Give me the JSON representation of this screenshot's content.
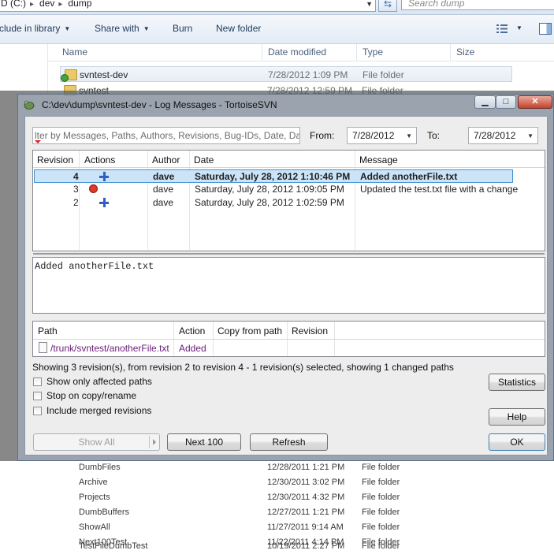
{
  "explorer": {
    "address_parts": [
      "D (C:)",
      "dev",
      "dump"
    ],
    "search_placeholder": "Search dump",
    "toolbar": {
      "include_in_library": "clude in library",
      "share_with": "Share with",
      "burn": "Burn",
      "new_folder": "New folder"
    },
    "columns": [
      "Name",
      "Date modified",
      "Type",
      "Size"
    ],
    "rows": [
      {
        "name": "svntest-dev",
        "date": "7/28/2012 1:09 PM",
        "type": "File folder"
      },
      {
        "name": "svntest",
        "date": "7/28/2012 12:59 PM",
        "type": "File folder"
      }
    ],
    "ghost_rows": [
      {
        "name": "DumbFiles",
        "date": "12/28/2011 1:21 PM",
        "type": "File folder"
      },
      {
        "name": "Archive",
        "date": "12/30/2011 3:02 PM",
        "type": "File folder"
      },
      {
        "name": "Projects",
        "date": "12/30/2011 4:32 PM",
        "type": "File folder"
      },
      {
        "name": "DumbBuffers",
        "date": "12/27/2011 1:21 PM",
        "type": "File folder"
      },
      {
        "name": "ShowAll",
        "date": "11/27/2011 9:14 AM",
        "type": "File folder"
      },
      {
        "name": "Next100Test",
        "date": "11/22/2011 4:14 PM",
        "type": "File folder"
      },
      {
        "name": "TestFileDumbTest",
        "date": "10/19/2011 2:27 PM",
        "type": "File folder"
      }
    ]
  },
  "dialog": {
    "title": "C:\\dev\\dump\\svntest-dev - Log Messages - TortoiseSVN",
    "filter_placeholder": "lter by Messages, Paths, Authors, Revisions, Bug-IDs, Date, Date Rar",
    "from_label": "From:",
    "from_value": "7/28/2012",
    "to_label": "To:",
    "to_value": "7/28/2012",
    "log_columns": [
      "Revision",
      "Actions",
      "Author",
      "Date",
      "Message"
    ],
    "log_rows": [
      {
        "revision": "4",
        "action": "added",
        "author": "dave",
        "date": "Saturday, July 28, 2012 1:10:46 PM",
        "message": "Added anotherFile.txt",
        "selected": true
      },
      {
        "revision": "3",
        "action": "modified",
        "author": "dave",
        "date": "Saturday, July 28, 2012 1:09:05 PM",
        "message": "Updated the test.txt file with a change",
        "selected": false
      },
      {
        "revision": "2",
        "action": "added",
        "author": "dave",
        "date": "Saturday, July 28, 2012 1:02:59 PM",
        "message": "",
        "selected": false
      }
    ],
    "message_text": "Added anotherFile.txt",
    "path_columns": [
      "Path",
      "Action",
      "Copy from path",
      "Revision"
    ],
    "path_rows": [
      {
        "path": "/trunk/svntest/anotherFile.txt",
        "action": "Added",
        "copy_from": "",
        "revision": ""
      }
    ],
    "status": "Showing 3 revision(s), from revision 2 to revision 4 - 1 revision(s) selected, showing 1 changed paths",
    "checkboxes": {
      "show_only_affected": "Show only affected paths",
      "stop_on_copy": "Stop on copy/rename",
      "include_merged": "Include merged revisions"
    },
    "buttons": {
      "statistics": "Statistics",
      "help": "Help",
      "show_all": "Show All",
      "next_100": "Next 100",
      "refresh": "Refresh",
      "ok": "OK"
    }
  }
}
